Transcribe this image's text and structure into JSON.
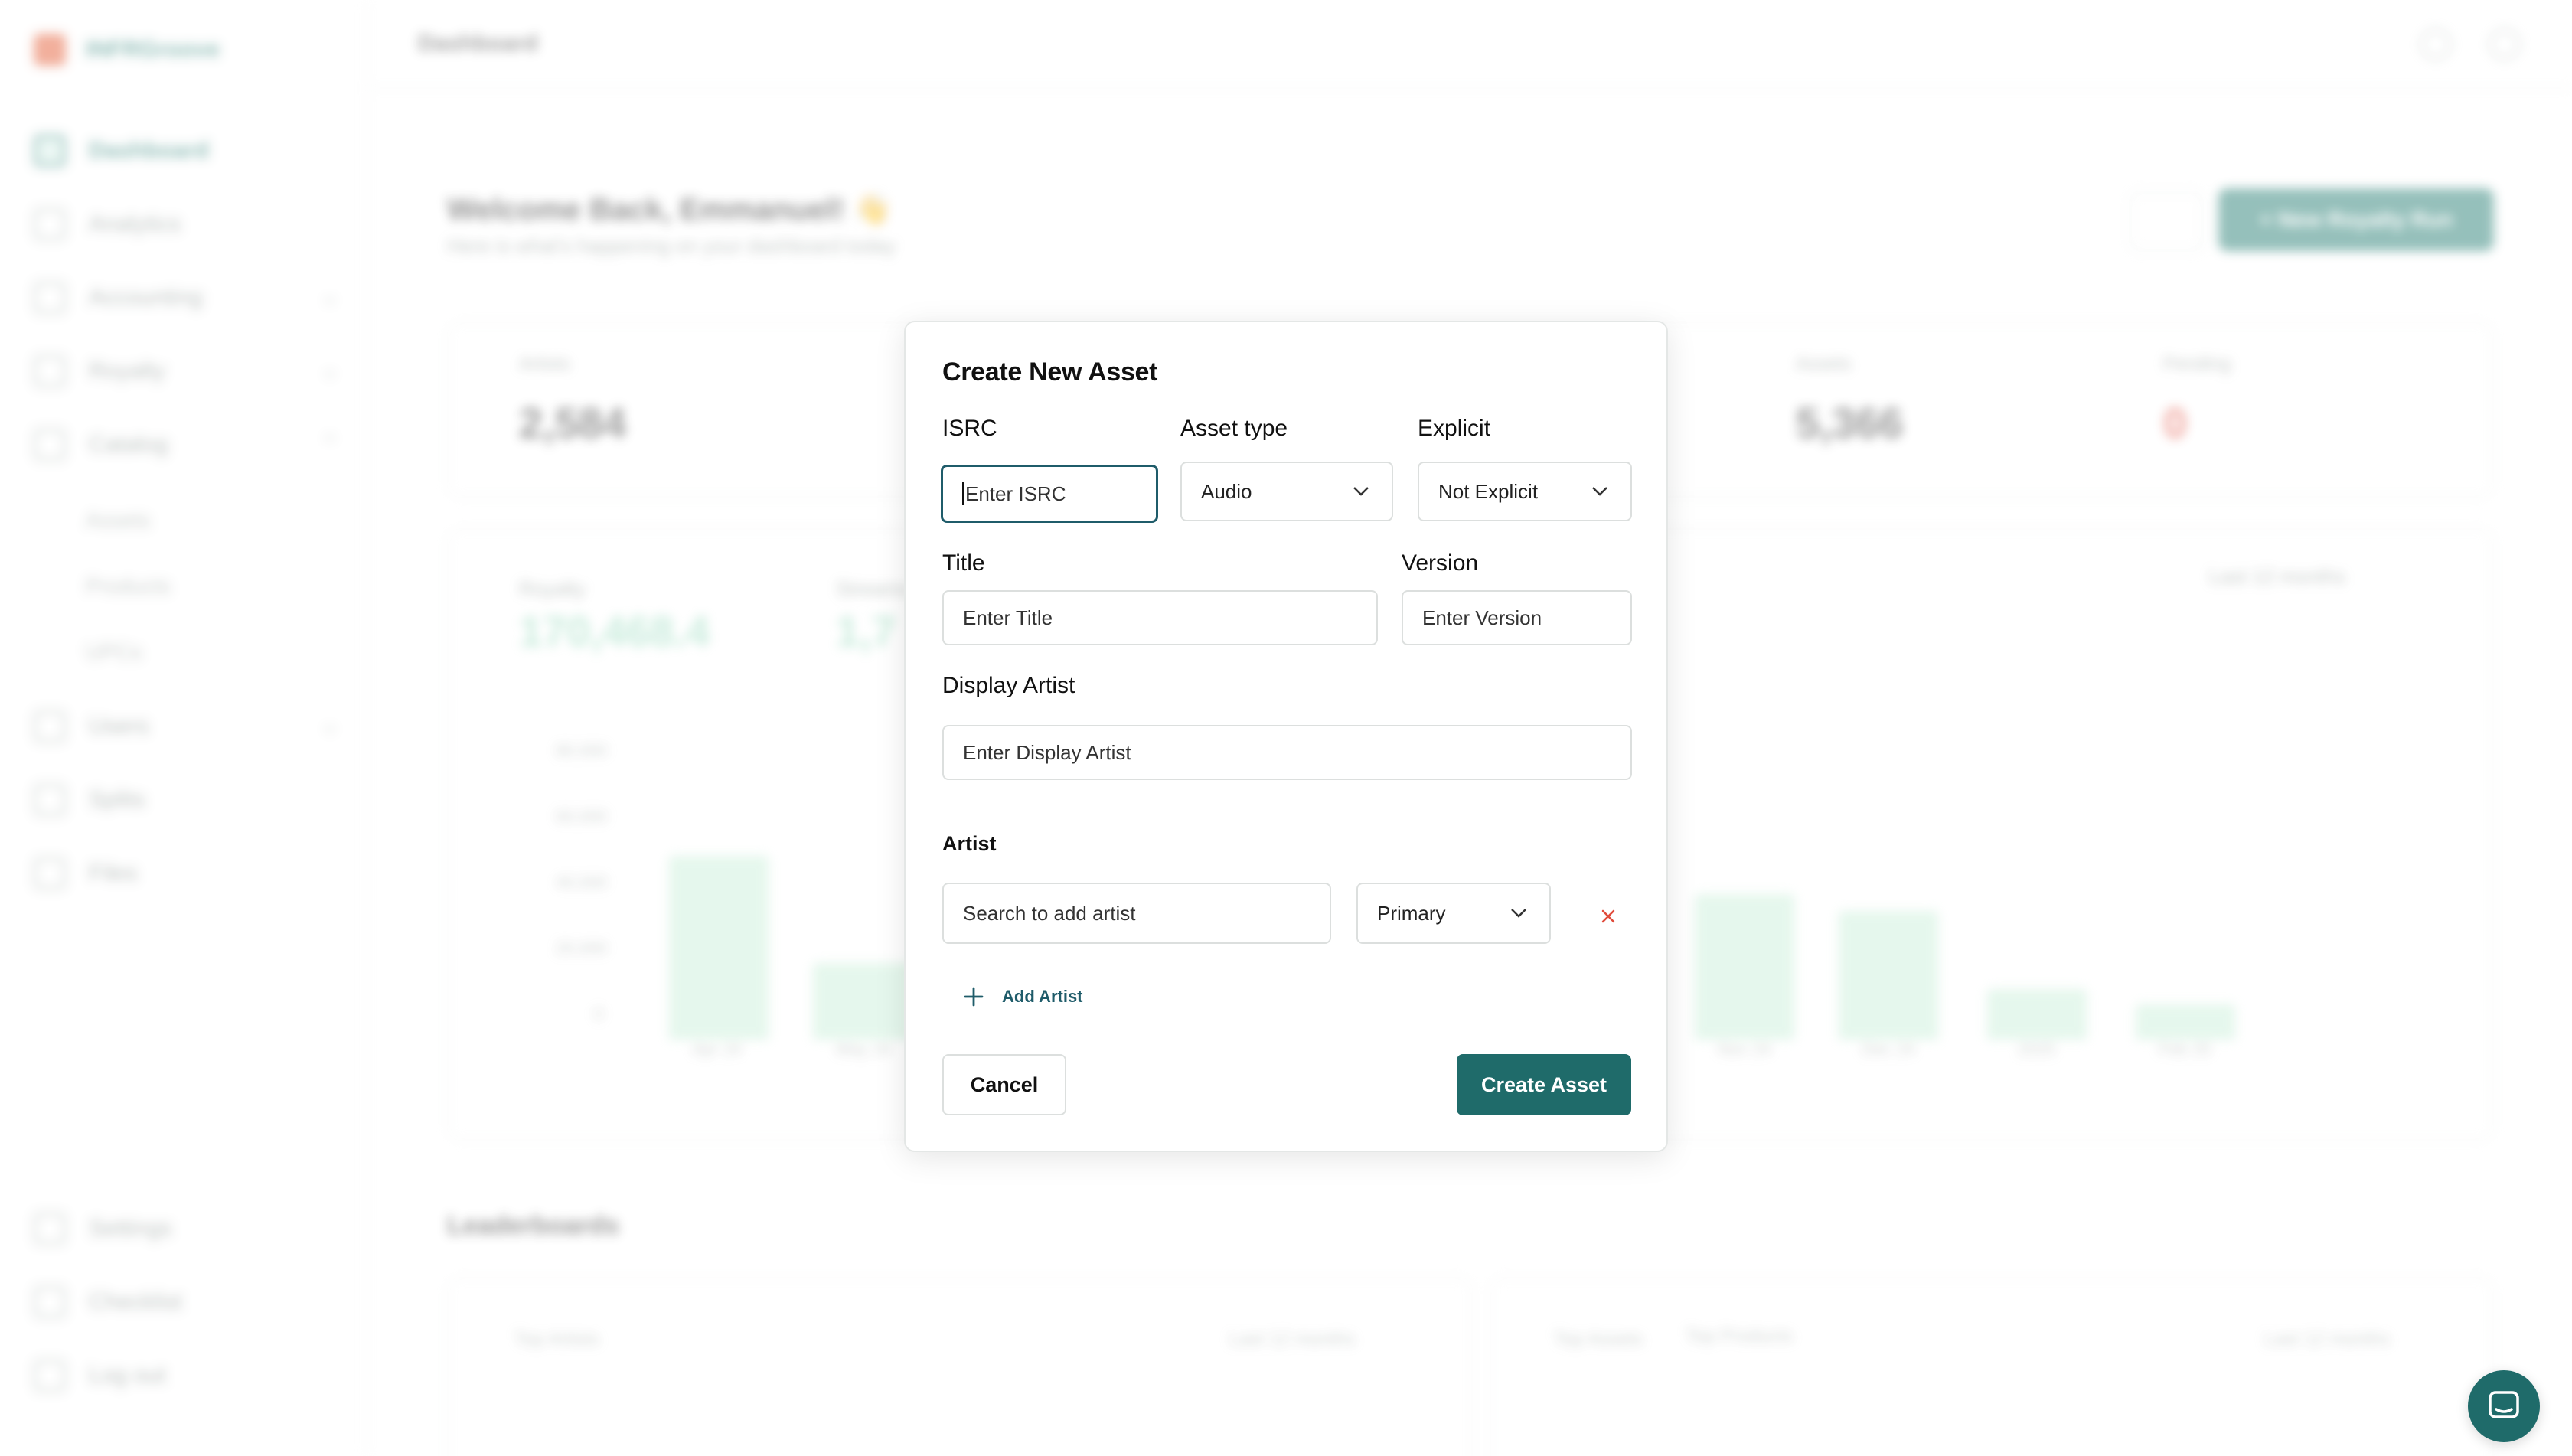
{
  "background": {
    "brand": "INFRGroove",
    "sidebar": {
      "items": [
        {
          "label": "Dashboard"
        },
        {
          "label": "Analytics"
        },
        {
          "label": "Accounting"
        },
        {
          "label": "Royalty"
        },
        {
          "label": "Catalog"
        },
        {
          "label": "Assets"
        },
        {
          "label": "Products"
        },
        {
          "label": "UPCs"
        },
        {
          "label": "Users"
        },
        {
          "label": "Splits"
        },
        {
          "label": "Files"
        },
        {
          "label": "Settings"
        },
        {
          "label": "Checklist"
        },
        {
          "label": "Log out"
        }
      ]
    },
    "topbar": {
      "breadcrumb": "Dashboard"
    },
    "welcome": {
      "title": "Welcome Back, Emmanuel! 👋",
      "subtitle": "Here is what's happening on your dashboard today"
    },
    "cta_label": "+ New Royalty Run",
    "stats": [
      {
        "label": "Artists",
        "value": "2,584"
      },
      {
        "label": "Assets",
        "value": "5,366"
      },
      {
        "label": "Pending",
        "value": "0"
      }
    ],
    "chart": {
      "royalty_label": "Royalty",
      "royalty_value": "170,468.4",
      "streams_label": "Streams",
      "streams_value": "1,7",
      "period": "Last 12 months",
      "y_ticks": [
        "80,000",
        "60,000",
        "40,000",
        "20,000",
        "0"
      ],
      "x_ticks": [
        "Apr 24",
        "May 24",
        "Nov 24",
        "Dec 24",
        "2025",
        "Feb 25"
      ]
    },
    "leaderboards": {
      "title": "Leaderboards",
      "top_artists": "Top Artists",
      "top_assets": "Top Assets",
      "top_products": "Top Products",
      "period": "Last 12 months"
    }
  },
  "modal": {
    "title": "Create New Asset",
    "isrc": {
      "label": "ISRC",
      "placeholder": "Enter ISRC"
    },
    "asset_type": {
      "label": "Asset type",
      "value": "Audio"
    },
    "explicit": {
      "label": "Explicit",
      "value": "Not Explicit"
    },
    "title_field": {
      "label": "Title",
      "placeholder": "Enter Title"
    },
    "version": {
      "label": "Version",
      "placeholder": "Enter Version"
    },
    "display_artist": {
      "label": "Display Artist",
      "placeholder": "Enter Display Artist"
    },
    "artist": {
      "label": "Artist",
      "search_placeholder": "Search to add artist",
      "role": "Primary"
    },
    "add_artist_label": "Add Artist",
    "cancel_label": "Cancel",
    "create_label": "Create Asset"
  },
  "colors": {
    "accent": "#1f6b6a",
    "focus_border": "#1f5c6a",
    "remove": "#e04a3a",
    "brand": "#1f7a6f"
  }
}
